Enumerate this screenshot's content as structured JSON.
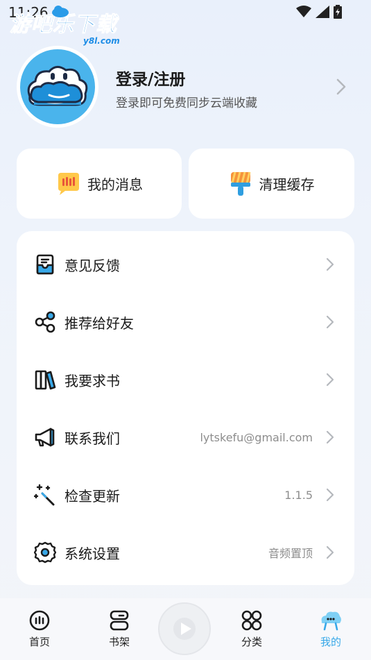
{
  "status_bar": {
    "time": "11:26"
  },
  "watermark": {
    "text": "游吧乐下载",
    "sub": "y8l.com"
  },
  "profile": {
    "title": "登录/注册",
    "subtitle": "登录即可免费同步云端收藏"
  },
  "quick_cards": [
    {
      "label": "我的消息",
      "icon": "message-icon"
    },
    {
      "label": "清理缓存",
      "icon": "brush-icon"
    }
  ],
  "menu": {
    "items": [
      {
        "label": "意见反馈",
        "value": "",
        "icon": "feedback-icon"
      },
      {
        "label": "推荐给好友",
        "value": "",
        "icon": "share-icon"
      },
      {
        "label": "我要求书",
        "value": "",
        "icon": "books-icon"
      },
      {
        "label": "联系我们",
        "value": "lytskefu@gmail.com",
        "icon": "megaphone-icon"
      },
      {
        "label": "检查更新",
        "value": "1.1.5",
        "icon": "magic-wand-icon"
      },
      {
        "label": "系统设置",
        "value": "音频置顶",
        "icon": "gear-icon"
      }
    ]
  },
  "bottom_nav": {
    "items": [
      {
        "label": "首页",
        "icon": "home-icon"
      },
      {
        "label": "书架",
        "icon": "bookshelf-icon"
      },
      {
        "label": "分类",
        "icon": "category-icon"
      },
      {
        "label": "我的",
        "icon": "profile-icon",
        "active": true
      }
    ]
  },
  "colors": {
    "accent": "#38a8e8",
    "avatar_bg": "#4ab4ec"
  }
}
